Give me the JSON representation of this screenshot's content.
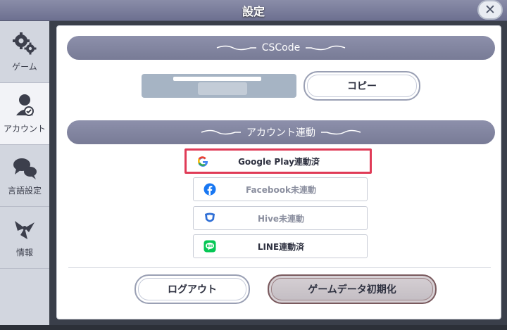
{
  "header": {
    "title": "設定",
    "close_label": "✕"
  },
  "sidebar": {
    "items": [
      {
        "label": "ゲーム",
        "icon": "gears-icon"
      },
      {
        "label": "アカウント",
        "icon": "user-check-icon"
      },
      {
        "label": "言語設定",
        "icon": "chat-bubbles-icon"
      },
      {
        "label": "情報",
        "icon": "info-icon"
      }
    ],
    "active": 1
  },
  "cscode": {
    "header": "CSCode",
    "copy_label": "コピー"
  },
  "account": {
    "header": "アカウント連動",
    "links": [
      {
        "label": "Google Play連動済",
        "icon": "google-icon",
        "linked": true
      },
      {
        "label": "Facebook未連動",
        "icon": "facebook-icon",
        "linked": false
      },
      {
        "label": "Hive未連動",
        "icon": "hive-icon",
        "linked": false
      },
      {
        "label": "LINE連動済",
        "icon": "line-icon",
        "linked": true
      }
    ]
  },
  "actions": {
    "logout_label": "ログアウト",
    "reset_label": "ゲームデータ初期化"
  },
  "colors": {
    "accent_header": "#80839e",
    "highlight": "#e03b57",
    "facebook": "#1877f2",
    "line": "#06c755",
    "hive": "#2f6fd6"
  }
}
